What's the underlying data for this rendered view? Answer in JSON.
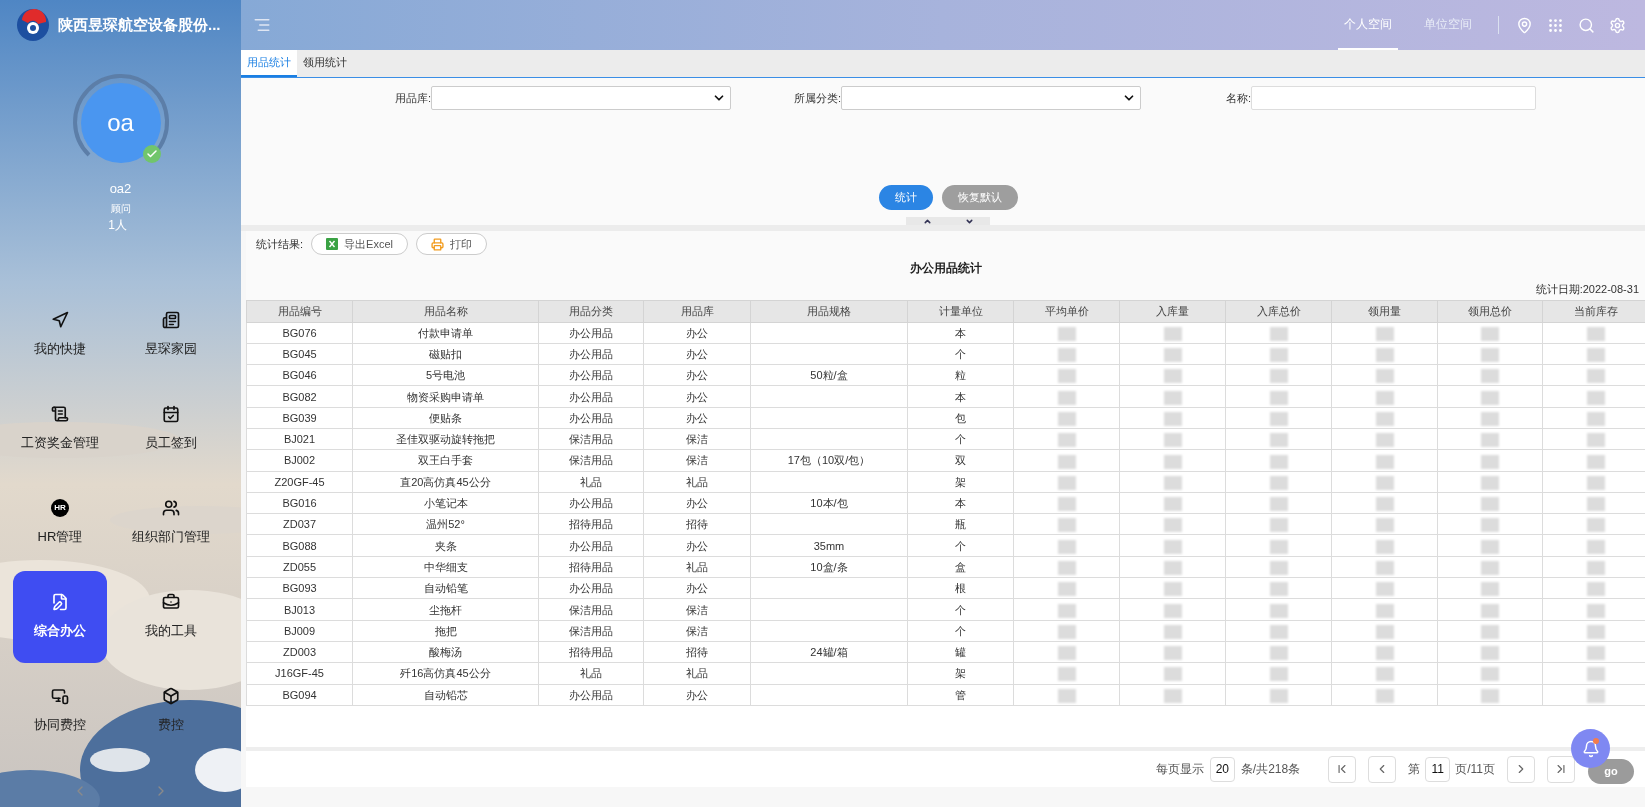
{
  "app": {
    "title": "陕西昱琛航空设备股份..."
  },
  "top_nav": [
    {
      "label": "个人空间",
      "selected": true
    },
    {
      "label": "单位空间",
      "selected": false
    }
  ],
  "user": {
    "avatar": "oa",
    "name": "oa2",
    "role": "顾问",
    "count": "1人",
    "verified": true
  },
  "sidebar": {
    "items": [
      {
        "label": "我的快捷",
        "selected": false
      },
      {
        "label": "昱琛家园",
        "selected": false
      },
      {
        "label": "工资奖金管理",
        "selected": false
      },
      {
        "label": "员工签到",
        "selected": false
      },
      {
        "label": "HR管理",
        "selected": false,
        "icon_text": "HR"
      },
      {
        "label": "组织部门管理",
        "selected": false
      },
      {
        "label": "综合办公",
        "selected": true
      },
      {
        "label": "我的工具",
        "selected": false
      },
      {
        "label": "协同费控",
        "selected": false
      },
      {
        "label": "费控",
        "selected": false
      }
    ]
  },
  "tabs": [
    {
      "label": "用品统计",
      "selected": true
    },
    {
      "label": "领用统计",
      "selected": false
    }
  ],
  "filters": [
    {
      "kind": "select",
      "label": "用品库:"
    },
    {
      "kind": "select",
      "label": "所属分类:"
    },
    {
      "kind": "text",
      "label": "名称:"
    }
  ],
  "buttons": [
    {
      "label": "统计",
      "kind": "primary"
    },
    {
      "label": "恢复默认",
      "kind": "secondary"
    }
  ],
  "results": {
    "label": "统计结果:",
    "actions": [
      {
        "label": "导出Excel",
        "kind": "excel"
      },
      {
        "label": "打印",
        "kind": "print"
      }
    ],
    "title": "办公用品统计",
    "date": "统计日期:2022-08-31"
  },
  "table": {
    "columns": [
      "用品编号",
      "用品名称",
      "用品分类",
      "用品库",
      "用品规格",
      "计量单位",
      "平均单价",
      "入库量",
      "入库总价",
      "领用量",
      "领用总价",
      "当前库存"
    ],
    "rows": [
      [
        "BG076",
        "付款申请单",
        "办公用品",
        "办公",
        "",
        "本"
      ],
      [
        "BG045",
        "磁贴扣",
        "办公用品",
        "办公",
        "",
        "个"
      ],
      [
        "BG046",
        "5号电池",
        "办公用品",
        "办公",
        "50粒/盒",
        "粒"
      ],
      [
        "BG082",
        "物资采购申请单",
        "办公用品",
        "办公",
        "",
        "本"
      ],
      [
        "BG039",
        "便贴条",
        "办公用品",
        "办公",
        "",
        "包"
      ],
      [
        "BJ021",
        "圣佳双驱动旋转拖把",
        "保洁用品",
        "保洁",
        "",
        "个"
      ],
      [
        "BJ002",
        "双王白手套",
        "保洁用品",
        "保洁",
        "17包（10双/包）",
        "双"
      ],
      [
        "Z20GF-45",
        "直20高仿真45公分",
        "礼品",
        "礼品",
        "",
        "架"
      ],
      [
        "BG016",
        "小笔记本",
        "办公用品",
        "办公",
        "10本/包",
        "本"
      ],
      [
        "ZD037",
        "温州52°",
        "招待用品",
        "招待",
        "",
        "瓶"
      ],
      [
        "BG088",
        "夹条",
        "办公用品",
        "办公",
        "35mm",
        "个"
      ],
      [
        "ZD055",
        "中华细支",
        "招待用品",
        "礼品",
        "10盒/条",
        "盒"
      ],
      [
        "BG093",
        "自动铅笔",
        "办公用品",
        "办公",
        "",
        "根"
      ],
      [
        "BJ013",
        "尘拖杆",
        "保洁用品",
        "保洁",
        "",
        "个"
      ],
      [
        "BJ009",
        "拖把",
        "保洁用品",
        "保洁",
        "",
        "个"
      ],
      [
        "ZD003",
        "酸梅汤",
        "招待用品",
        "招待",
        "24罐/箱",
        "罐"
      ],
      [
        "J16GF-45",
        "歼16高仿真45公分",
        "礼品",
        "礼品",
        "",
        "架"
      ],
      [
        "BG094",
        "自动铅芯",
        "办公用品",
        "办公",
        "",
        "管"
      ]
    ]
  },
  "pagination": {
    "per_page_label": "每页显示",
    "per_page": "20",
    "total": "条/共218条",
    "page_prefix": "第",
    "page": "11",
    "page_suffix": "页/11页",
    "go": "go"
  },
  "notification": {
    "unread": true
  }
}
